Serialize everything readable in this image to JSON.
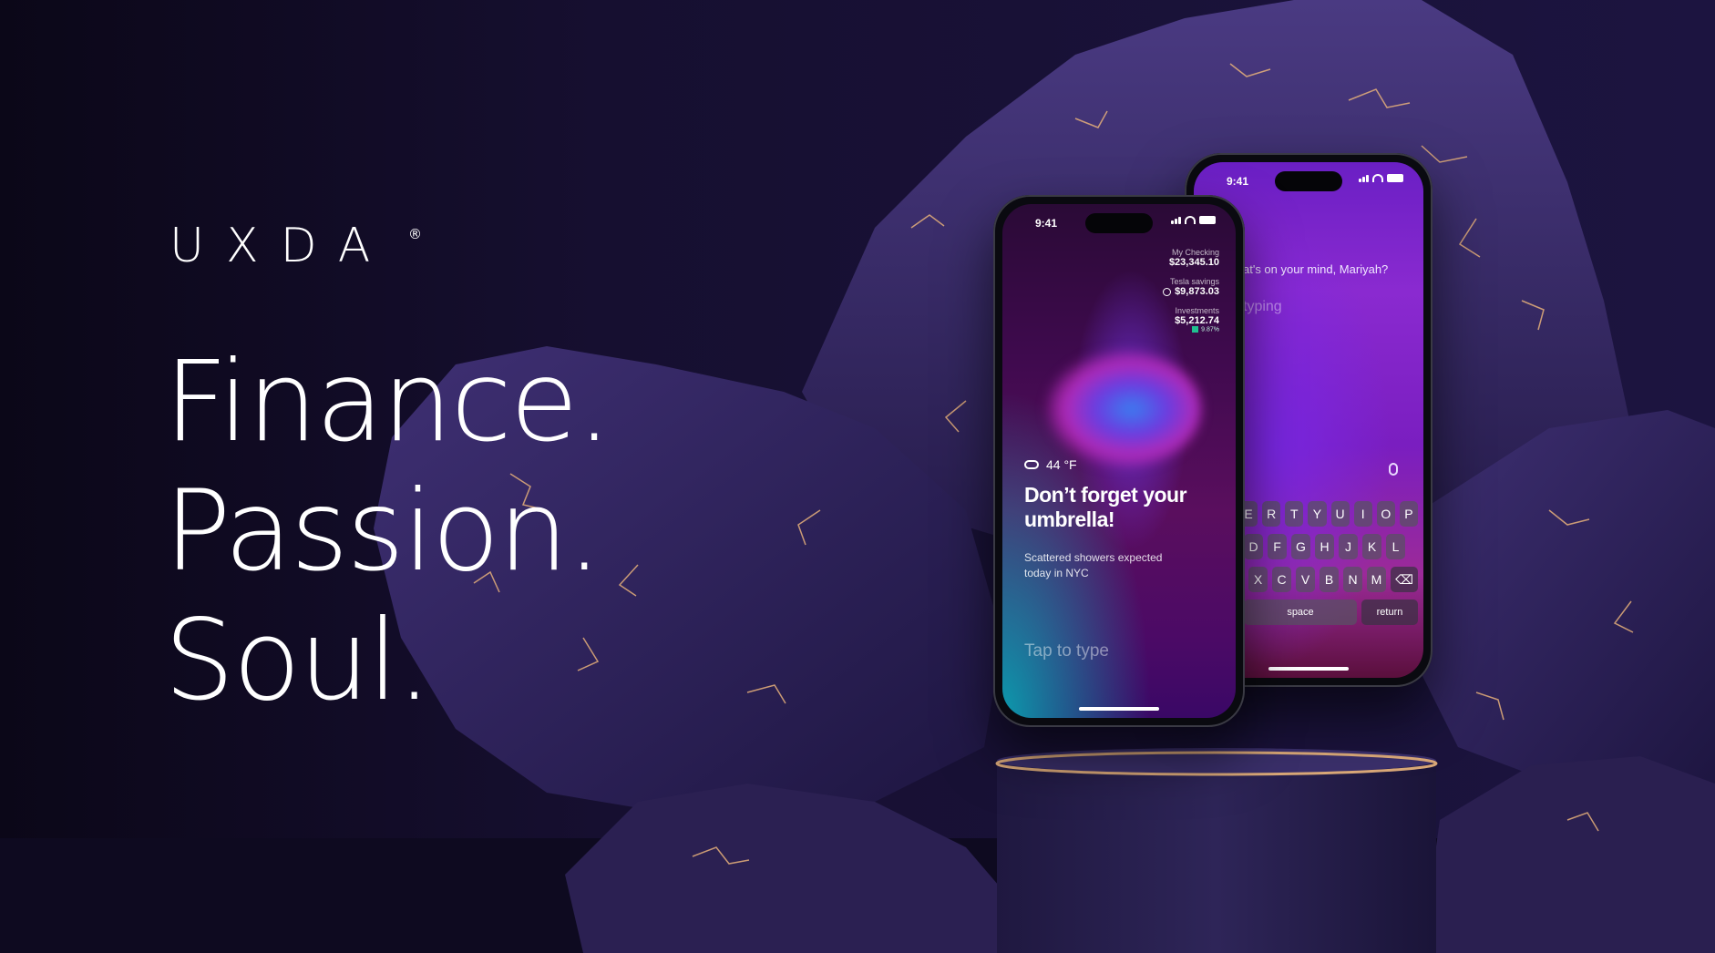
{
  "brand": {
    "logo": "UXDA",
    "registered": "®"
  },
  "headline": [
    "Finance.",
    "Passion.",
    "Soul."
  ],
  "colors": {
    "background": "#120c26",
    "rock": "#3b2c6a",
    "gold_vein": "#e6b07a",
    "pedestal": "#2c2250"
  },
  "phone_front": {
    "time": "9:41",
    "accounts": [
      {
        "label": "My Checking",
        "value": "$23,345.10"
      },
      {
        "label": "Tesla savings",
        "value": "$9,873.03"
      },
      {
        "label": "Investments",
        "value": "$5,212.74",
        "change": "9.87%"
      }
    ],
    "temperature": "44 °F",
    "message": "Don’t forget your umbrella!",
    "sub_message": "Scattered showers expected today in NYC",
    "input_placeholder": "Tap to type",
    "icons": [
      "cloud-icon",
      "signal-icon",
      "wifi-icon",
      "battery-icon"
    ]
  },
  "phone_back": {
    "time": "9:41",
    "prompt": "at's on your mind, Mariyah?",
    "typing": "typing",
    "keyboard": {
      "row1": [
        "E",
        "R",
        "T",
        "Y",
        "U",
        "I",
        "O",
        "P"
      ],
      "row2": [
        "D",
        "F",
        "G",
        "H",
        "J",
        "K",
        "L"
      ],
      "row3": [
        "X",
        "C",
        "V",
        "B",
        "N",
        "M"
      ],
      "space": "space",
      "return": "return"
    },
    "icons": [
      "mic-icon",
      "backspace-icon"
    ]
  }
}
